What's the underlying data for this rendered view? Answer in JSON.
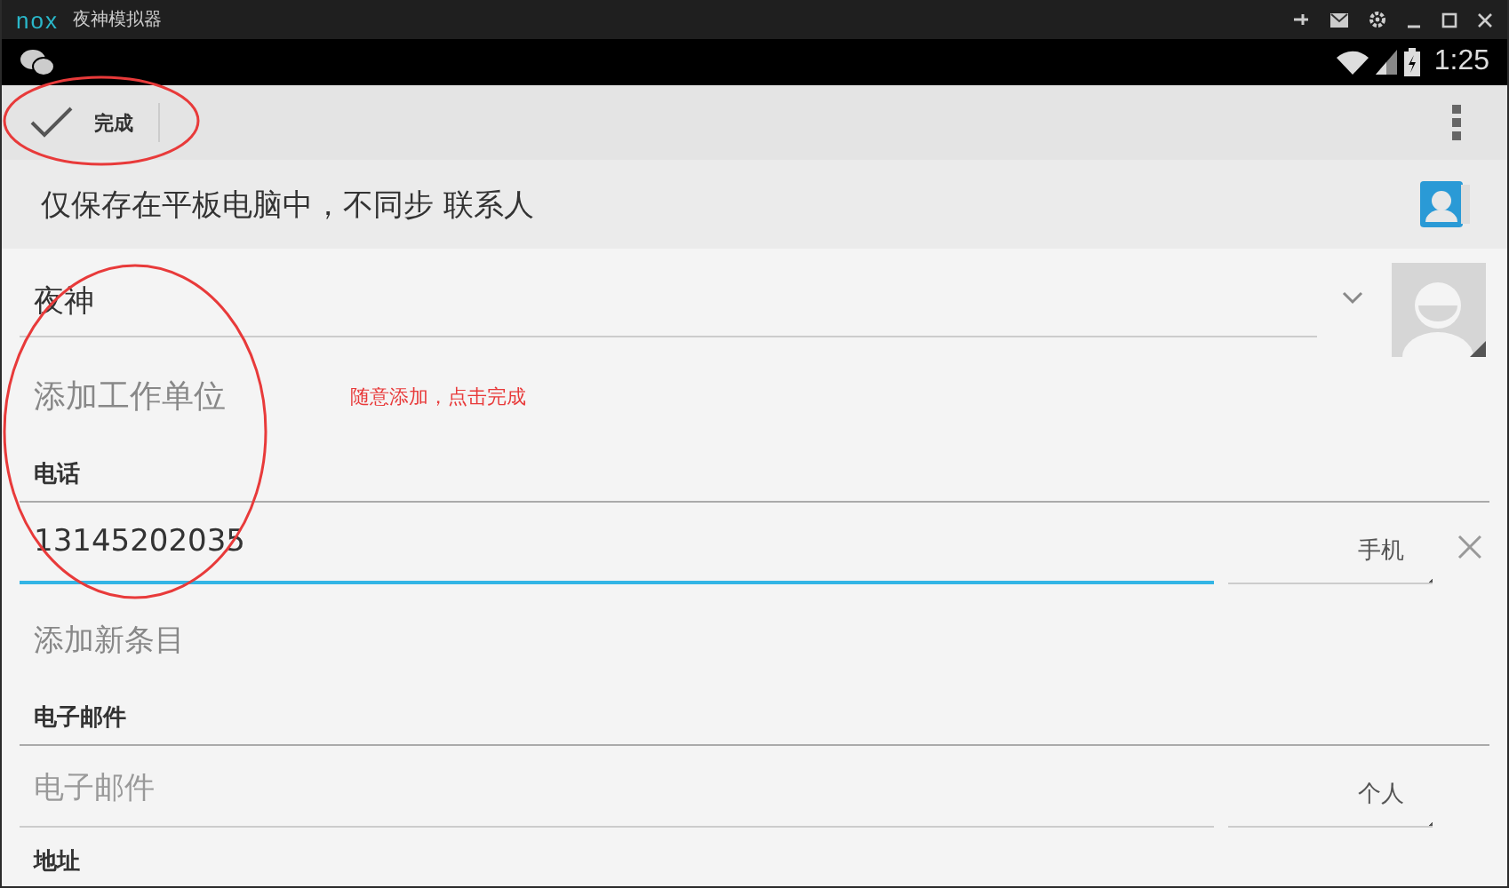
{
  "window": {
    "logo": "nox",
    "title": "夜神模拟器"
  },
  "status_bar": {
    "time": "1:25"
  },
  "action_bar": {
    "done": "完成"
  },
  "account": {
    "text": "仅保存在平板电脑中，不同步 联系人"
  },
  "name_field": {
    "value": "夜神"
  },
  "add_organization": "添加工作单位",
  "annotation": "随意添加，点击完成",
  "sections": [
    {
      "title": "电话",
      "fields": [
        {
          "value": "13145202035",
          "type": "手机",
          "focused": true,
          "removable": true
        }
      ],
      "add_link": "添加新条目"
    },
    {
      "title": "电子邮件",
      "fields": [
        {
          "placeholder": "电子邮件",
          "type": "个人",
          "focused": false
        }
      ]
    },
    {
      "title": "地址"
    }
  ]
}
